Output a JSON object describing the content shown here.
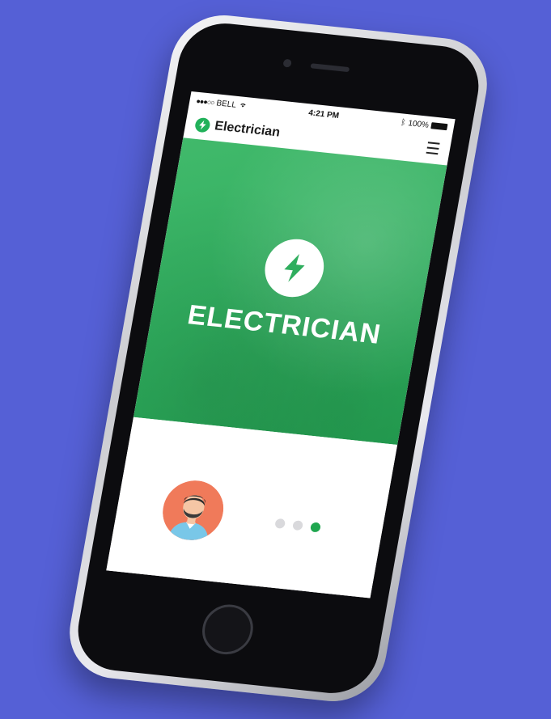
{
  "status_bar": {
    "carrier": "BELL",
    "time": "4:21 PM",
    "battery": "100%"
  },
  "app": {
    "brand_name": "Electrician",
    "menu_icon": "hamburger-menu-icon"
  },
  "hero": {
    "title": "ELECTRICIAN",
    "icon": "lightning-bolt-icon",
    "accent_color": "#2fae5e"
  },
  "carousel": {
    "dot_count": 3,
    "active_index": 2,
    "active_color": "#1fa64f"
  },
  "colors": {
    "background": "#5560d6",
    "brand_green": "#21b15a"
  }
}
